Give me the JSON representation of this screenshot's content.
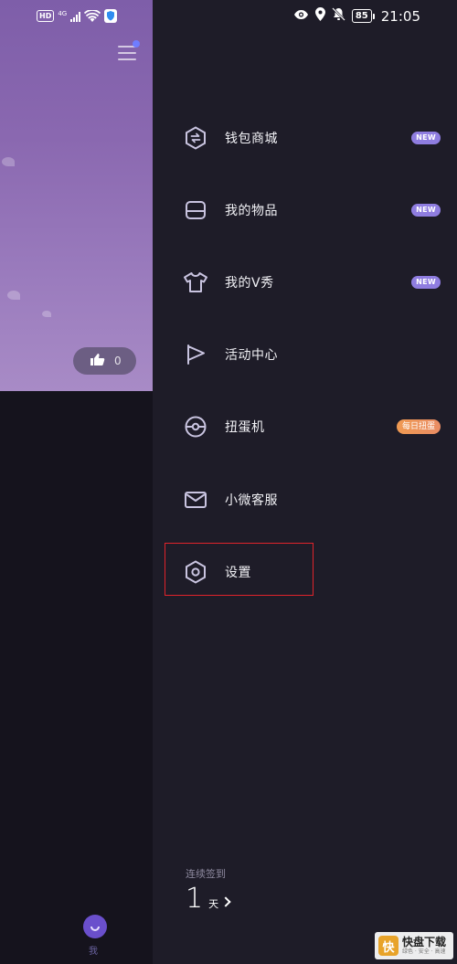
{
  "status_bar": {
    "hd": "HD",
    "network": "4G",
    "battery": "85",
    "time": "21:05"
  },
  "background_page": {
    "like_count": "0",
    "tab_me_label": "我"
  },
  "drawer": {
    "items": [
      {
        "label": "钱包商城",
        "icon": "wallet-exchange-icon",
        "badge": "NEW"
      },
      {
        "label": "我的物品",
        "icon": "inbox-tray-icon",
        "badge": "NEW"
      },
      {
        "label": "我的V秀",
        "icon": "tshirt-icon",
        "badge": "NEW"
      },
      {
        "label": "活动中心",
        "icon": "flag-icon",
        "badge": ""
      },
      {
        "label": "扭蛋机",
        "icon": "capsule-ball-icon",
        "badge": "每日扭蛋"
      },
      {
        "label": "小微客服",
        "icon": "mail-icon",
        "badge": ""
      },
      {
        "label": "设置",
        "icon": "settings-hexagon-icon",
        "badge": ""
      }
    ],
    "checkin": {
      "label": "连续签到",
      "days": "1",
      "unit": "天"
    }
  },
  "watermark": {
    "logo": "快",
    "title": "快盘下载",
    "subtitle": "绿色 · 安全 · 高速"
  },
  "colors": {
    "drawer_bg": "#1e1c28",
    "new_badge": "#8f7de0",
    "daily_badge": "#f09a52",
    "highlight": "#e0232b",
    "hero_purple": "#8a68b0"
  }
}
